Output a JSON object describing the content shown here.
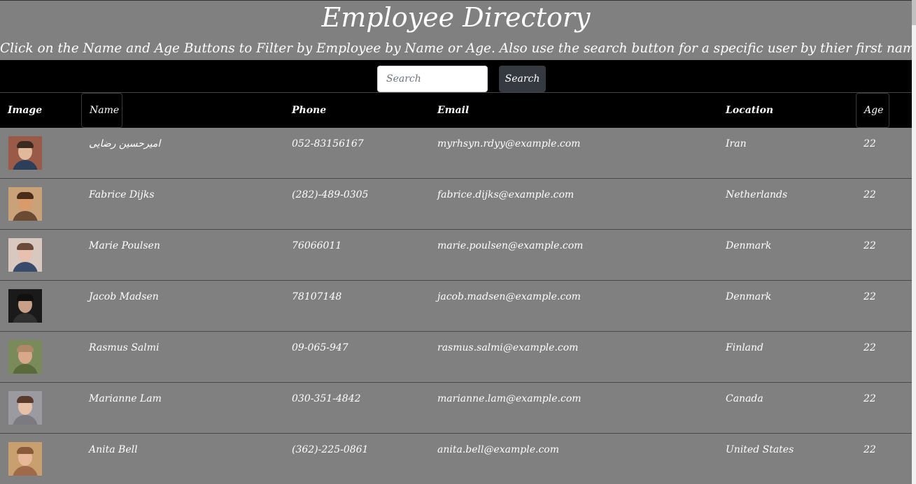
{
  "header": {
    "title": "Employee Directory",
    "subtitle": "Click on the Name and Age Buttons to Filter by Employee by Name or Age. Also use the search button for a specific user by thier first name."
  },
  "search": {
    "placeholder": "Search",
    "value": "",
    "button_label": "Search"
  },
  "table": {
    "columns": {
      "image": "Image",
      "name": "Name",
      "phone": "Phone",
      "email": "Email",
      "location": "Location",
      "age": "Age"
    },
    "rows": [
      {
        "name": "امیرحسین رضایی",
        "phone": "052-83156167",
        "email": "myrhsyn.rdyy@example.com",
        "location": "Iran",
        "age": "22"
      },
      {
        "name": "Fabrice Dijks",
        "phone": "(282)-489-0305",
        "email": "fabrice.dijks@example.com",
        "location": "Netherlands",
        "age": "22"
      },
      {
        "name": "Marie Poulsen",
        "phone": "76066011",
        "email": "marie.poulsen@example.com",
        "location": "Denmark",
        "age": "22"
      },
      {
        "name": "Jacob Madsen",
        "phone": "78107148",
        "email": "jacob.madsen@example.com",
        "location": "Denmark",
        "age": "22"
      },
      {
        "name": "Rasmus Salmi",
        "phone": "09-065-947",
        "email": "rasmus.salmi@example.com",
        "location": "Finland",
        "age": "22"
      },
      {
        "name": "Marianne Lam",
        "phone": "030-351-4842",
        "email": "marianne.lam@example.com",
        "location": "Canada",
        "age": "22"
      },
      {
        "name": "Anita Bell",
        "phone": "(362)-225-0861",
        "email": "anita.bell@example.com",
        "location": "United States",
        "age": "22"
      }
    ]
  },
  "colors": {
    "page_background": "#808080",
    "bar_background": "#000000",
    "button_dark": "#343a40",
    "text": "#ffffff"
  }
}
